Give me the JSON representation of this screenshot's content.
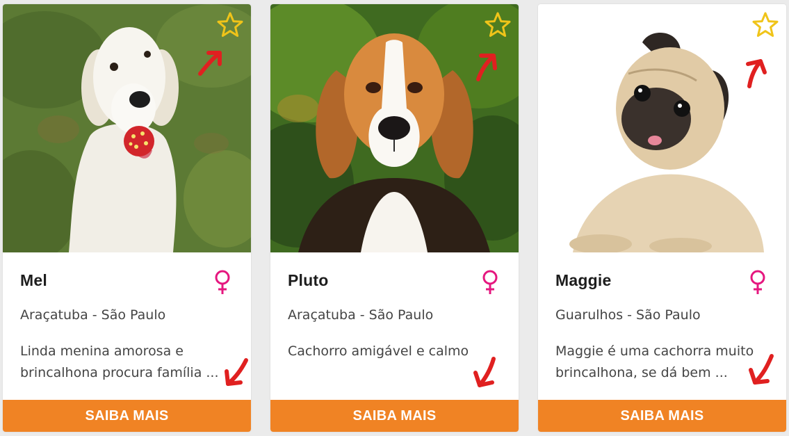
{
  "colors": {
    "button": "#f08324",
    "gender_icon": "#e5177f",
    "favorite_star": "#f0c419",
    "annotation_arrow": "#e02020"
  },
  "cards": [
    {
      "name": "Mel",
      "gender_icon": "female-icon",
      "location": "Araçatuba - São Paulo",
      "description": "Linda menina amorosa e brincalhona procura família ...",
      "button_label": "SAIBA MAIS",
      "favorite_icon": "star-outline-icon",
      "image": "white-golden-retriever-on-grass-photo"
    },
    {
      "name": "Pluto",
      "gender_icon": "female-icon",
      "location": "Araçatuba - São Paulo",
      "description": "Cachorro amigável e calmo",
      "button_label": "SAIBA MAIS",
      "favorite_icon": "star-outline-icon",
      "image": "beagle-portrait-photo"
    },
    {
      "name": "Maggie",
      "gender_icon": "female-icon",
      "location": "Guarulhos - São Paulo",
      "description": "Maggie é uma cachorra muito brincalhona, se dá bem ...",
      "button_label": "SAIBA MAIS",
      "favorite_icon": "star-outline-icon",
      "image": "pug-white-background-photo"
    }
  ]
}
